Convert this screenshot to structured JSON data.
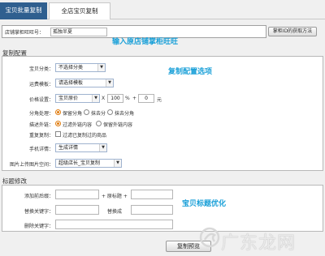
{
  "tabs": [
    {
      "label": "宝贝批量复制",
      "active": false
    },
    {
      "label": "全店宝贝复制",
      "active": true
    }
  ],
  "shop": {
    "label": "店铺掌柜旺旺号：",
    "value": "孤独半夏",
    "get_id_button": "掌柜ID的获取方法",
    "annotation": "输入原店铺掌柜旺旺"
  },
  "copy_config": {
    "title": "复制配置",
    "annotation": "复制配置选项",
    "category": {
      "label": "宝贝分类：",
      "value": "不选择分类"
    },
    "template": {
      "label": "运费模板：",
      "value": "请选择模板"
    },
    "price": {
      "label": "价格设置：",
      "base": "宝贝原价",
      "times": "X",
      "multiplier": "100",
      "percent": "%",
      "plus": "+",
      "add": "0",
      "unit": "元"
    },
    "rounding": {
      "label": "分角处理：",
      "options": [
        {
          "text": "保留分角",
          "checked": true
        },
        {
          "text": "抹去分",
          "checked": false
        },
        {
          "text": "抹去分角",
          "checked": false
        }
      ]
    },
    "desc_link": {
      "label": "描述外链：",
      "options": [
        {
          "text": "过滤外链内容",
          "checked": true
        },
        {
          "text": "保留外链内容",
          "checked": false
        }
      ]
    },
    "duplicate": {
      "label": "重复复制：",
      "checkbox": "过滤已复制过的商品",
      "checked": false
    },
    "mobile": {
      "label": "手机详情：",
      "value": "生成详情"
    },
    "image_space": {
      "label": "图片上传图片空间：",
      "value": "超级店长_宝贝复制"
    }
  },
  "title_edit": {
    "title": "标题修改",
    "annotation": "宝贝标题优化",
    "prefix_label": "添加前后缀：",
    "plus_label": "+ 原标题 +",
    "replace_label": "替换关键字：",
    "replace_with_label": "替换成",
    "delete_label": "删除关键字："
  },
  "preview_button": "复制预览",
  "watermark": "广东龙网",
  "colors": {
    "accent": "#1aa0d8",
    "tab_active": "#2f5f8f",
    "radio": "#e07a0b"
  }
}
